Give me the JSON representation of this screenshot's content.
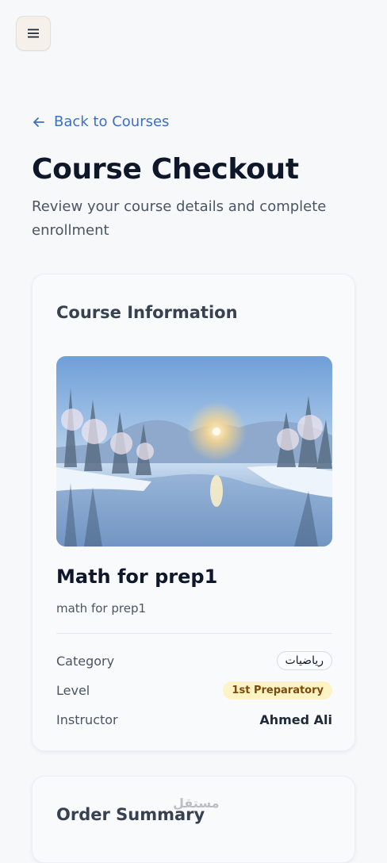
{
  "header": {
    "menu_icon": "hamburger-menu-icon"
  },
  "back_link": {
    "label": "Back to Courses",
    "icon": "arrow-left-icon"
  },
  "page": {
    "title": "Course Checkout",
    "subtitle": "Review your course details and complete enrollment"
  },
  "course_info": {
    "heading": "Course Information",
    "image_alt": "snowy river landscape at sunrise",
    "name": "Math for prep1",
    "description": "math for prep1",
    "details": {
      "category_label": "Category",
      "category_value": "رياضيات",
      "level_label": "Level",
      "level_value": "1st Preparatory",
      "instructor_label": "Instructor",
      "instructor_value": "Ahmed Ali"
    }
  },
  "order_summary": {
    "heading": "Order Summary"
  },
  "watermark": {
    "text": "مستقل"
  },
  "colors": {
    "accent_link": "#3b6fc7",
    "level_badge_bg": "#fdf3c4",
    "level_badge_text": "#7a4b0e",
    "page_bg": "#f7f8fa"
  }
}
